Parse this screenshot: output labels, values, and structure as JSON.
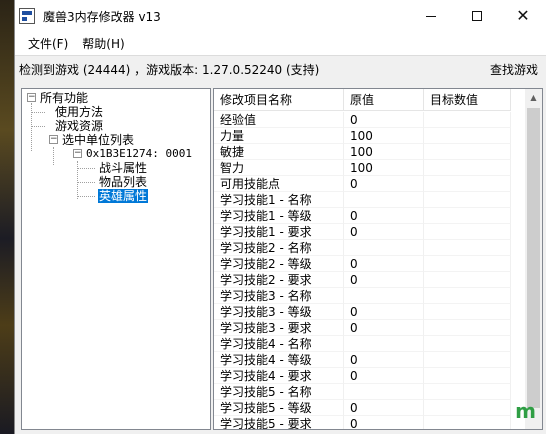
{
  "window": {
    "title": "魔兽3内存修改器 v13",
    "icon": "app-icon"
  },
  "menu": {
    "items": [
      "文件(F)",
      "帮助(H)"
    ]
  },
  "status": {
    "text": "检测到游戏 (24444) ，游戏版本: 1.27.0.52240 (支持)",
    "find_button": "查找游戏"
  },
  "tree": {
    "root": "所有功能",
    "usage": "使用方法",
    "resources": "游戏资源",
    "selected_units": "选中单位列表",
    "unit": "0x1B3E1274: 0001",
    "combat": "战斗属性",
    "items": "物品列表",
    "hero": "英雄属性"
  },
  "grid": {
    "headers": [
      "修改项目名称",
      "原值",
      "目标数值"
    ],
    "rows": [
      [
        "经验值",
        "0",
        ""
      ],
      [
        "力量",
        "100",
        ""
      ],
      [
        "敏捷",
        "100",
        ""
      ],
      [
        "智力",
        "100",
        ""
      ],
      [
        "可用技能点",
        "0",
        ""
      ],
      [
        "学习技能1 - 名称",
        "",
        ""
      ],
      [
        "学习技能1 - 等级",
        "0",
        ""
      ],
      [
        "学习技能1 - 要求",
        "0",
        ""
      ],
      [
        "学习技能2 - 名称",
        "",
        ""
      ],
      [
        "学习技能2 - 等级",
        "0",
        ""
      ],
      [
        "学习技能2 - 要求",
        "0",
        ""
      ],
      [
        "学习技能3 - 名称",
        "",
        ""
      ],
      [
        "学习技能3 - 等级",
        "0",
        ""
      ],
      [
        "学习技能3 - 要求",
        "0",
        ""
      ],
      [
        "学习技能4 - 名称",
        "",
        ""
      ],
      [
        "学习技能4 - 等级",
        "0",
        ""
      ],
      [
        "学习技能4 - 要求",
        "0",
        ""
      ],
      [
        "学习技能5 - 名称",
        "",
        ""
      ],
      [
        "学习技能5 - 等级",
        "0",
        ""
      ],
      [
        "学习技能5 - 要求",
        "0",
        ""
      ]
    ]
  },
  "watermark": "m",
  "colors": {
    "selection": "#0078d7",
    "watermark": "#2f9e44"
  }
}
